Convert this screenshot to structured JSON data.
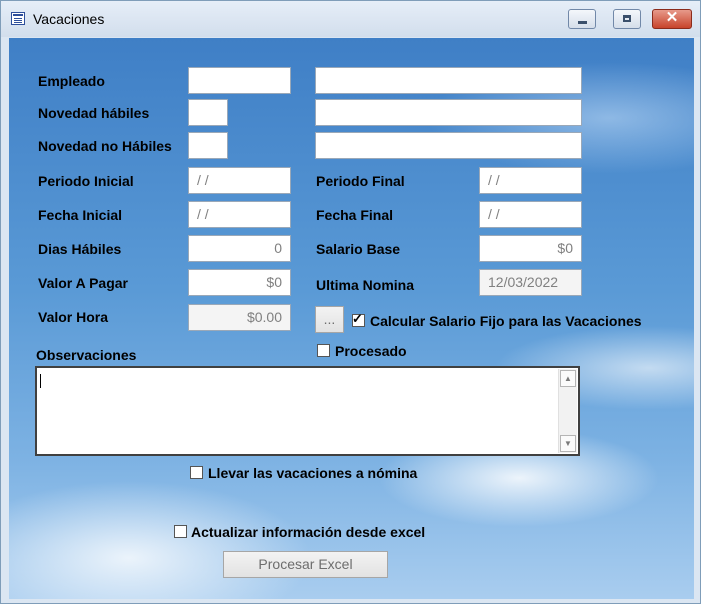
{
  "window": {
    "title": "Vacaciones",
    "controls": {
      "minimize_icon": "minimize-icon",
      "maximize_icon": "maximize-icon",
      "close_icon": "close-icon",
      "close_glyph": "✕"
    }
  },
  "labels": {
    "empleado": "Empleado",
    "novedad_habiles": "Novedad hábiles",
    "novedad_no_habiles": "Novedad no Hábiles",
    "periodo_inicial": "Periodo Inicial",
    "periodo_final": "Periodo Final",
    "fecha_inicial": "Fecha Inicial",
    "fecha_final": "Fecha Final",
    "dias_habiles": "Dias Hábiles",
    "salario_base": "Salario Base",
    "valor_a_pagar": "Valor A Pagar",
    "ultima_nomina": "Ultima Nomina",
    "valor_hora": "Valor Hora",
    "observaciones": "Observaciones"
  },
  "fields": {
    "empleado_code": "",
    "empleado_name": "",
    "novedad_habiles_code": "",
    "novedad_habiles_name": "",
    "novedad_no_habiles_code": "",
    "novedad_no_habiles_name": "",
    "periodo_inicial": "/ /",
    "periodo_final": "/ /",
    "fecha_inicial": "/ /",
    "fecha_final": "/ /",
    "dias_habiles": "0",
    "salario_base": "$0",
    "valor_a_pagar": "$0",
    "ultima_nomina": "12/03/2022",
    "valor_hora": "$0.00",
    "observaciones": ""
  },
  "buttons": {
    "ellipsis": "...",
    "procesar_excel": "Procesar Excel"
  },
  "checkboxes": {
    "calcular_salario_fijo": {
      "label": "Calcular Salario Fijo para las Vacaciones",
      "checked": true,
      "mark": "✓"
    },
    "procesado": {
      "label": "Procesado",
      "checked": false
    },
    "llevar_a_nomina": {
      "label": "Llevar las vacaciones a nómina",
      "checked": false
    },
    "actualizar_desde_excel": {
      "label": "Actualizar información desde excel",
      "checked": false
    }
  },
  "scrollbar": {
    "up_glyph": "▲",
    "down_glyph": "▼"
  }
}
